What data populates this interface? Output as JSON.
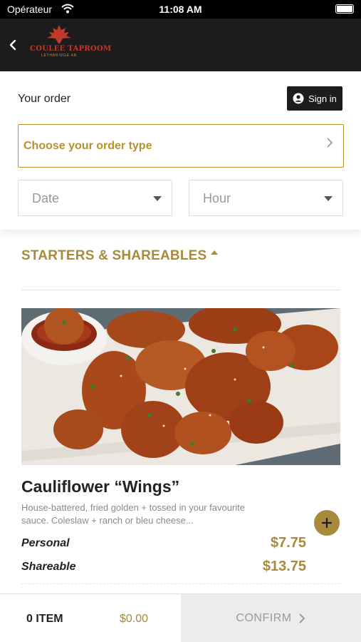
{
  "status_bar": {
    "carrier": "Opérateur",
    "time": "11:08 AM"
  },
  "navbar": {
    "back_icon": "chevron-left-icon",
    "logo_name": "COULEE TAPROOM",
    "logo_sub": "LETHBRIDGE AB"
  },
  "order": {
    "title": "Your order",
    "signin_label": "Sign in",
    "order_type_label": "Choose your order type",
    "date_placeholder": "Date",
    "hour_placeholder": "Hour"
  },
  "section": {
    "title": "STARTERS & SHAREABLES",
    "expanded": true
  },
  "product": {
    "name": "Cauliflower “Wings”",
    "description": "House-battered, fried golden + tossed in your favourite sauce. Coleslaw + ranch or bleu cheese...",
    "options": [
      {
        "size": "Personal",
        "price": "$7.75"
      },
      {
        "size": "Shareable",
        "price": "$13.75"
      }
    ]
  },
  "cart": {
    "item_count": "0 ITEM",
    "total": "$0.00",
    "confirm_label": "CONFIRM"
  },
  "colors": {
    "accent_gold": "#a88a3d",
    "navbar_bg": "#1c1c1c",
    "logo_red": "#c0392b"
  }
}
